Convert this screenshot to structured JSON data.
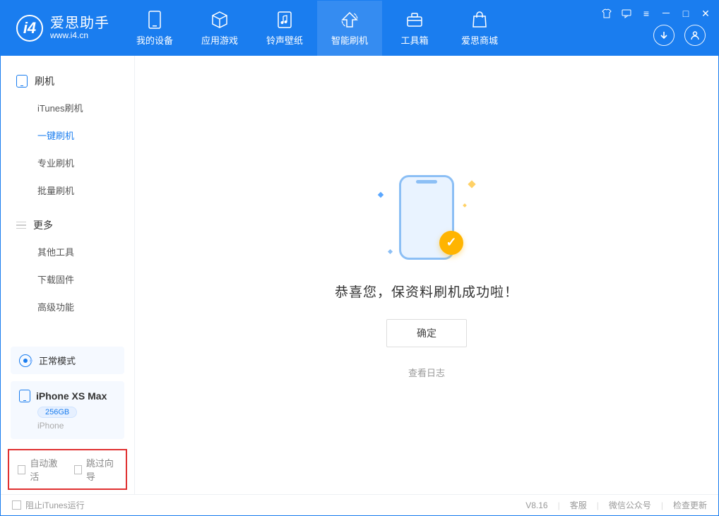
{
  "app": {
    "name_cn": "爱思助手",
    "name_en": "www.i4.cn",
    "logo_letter": "i4"
  },
  "nav": {
    "items": [
      {
        "label": "我的设备",
        "icon": "device"
      },
      {
        "label": "应用游戏",
        "icon": "cube"
      },
      {
        "label": "铃声壁纸",
        "icon": "music"
      },
      {
        "label": "智能刷机",
        "icon": "refresh"
      },
      {
        "label": "工具箱",
        "icon": "toolbox"
      },
      {
        "label": "爱思商城",
        "icon": "bag"
      }
    ],
    "active_index": 3
  },
  "sidebar": {
    "group1_label": "刷机",
    "group1_items": [
      "iTunes刷机",
      "一键刷机",
      "专业刷机",
      "批量刷机"
    ],
    "group1_active_index": 1,
    "group2_label": "更多",
    "group2_items": [
      "其他工具",
      "下载固件",
      "高级功能"
    ]
  },
  "device": {
    "mode_label": "正常模式",
    "name": "iPhone XS Max",
    "capacity": "256GB",
    "type": "iPhone"
  },
  "checkboxes": {
    "auto_activate": "自动激活",
    "skip_guide": "跳过向导"
  },
  "main": {
    "success_text": "恭喜您，保资料刷机成功啦！",
    "ok_button": "确定",
    "view_log": "查看日志"
  },
  "footer": {
    "block_itunes": "阻止iTunes运行",
    "version": "V8.16",
    "links": [
      "客服",
      "微信公众号",
      "检查更新"
    ]
  }
}
